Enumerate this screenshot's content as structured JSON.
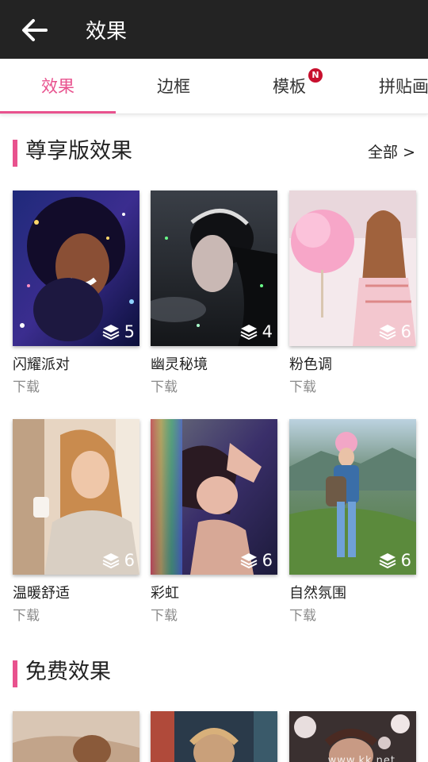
{
  "header": {
    "title": "效果",
    "back_icon": "arrow-left-icon"
  },
  "tabs": [
    {
      "label": "效果",
      "active": true
    },
    {
      "label": "边框",
      "active": false
    },
    {
      "label": "模板",
      "active": false,
      "badge": "N"
    },
    {
      "label": "拼贴画",
      "active": false
    }
  ],
  "premium": {
    "title": "尊享版效果",
    "all_label": "全部 >",
    "items": [
      {
        "name": "闪耀派对",
        "status": "下载",
        "count": "5"
      },
      {
        "name": "幽灵秘境",
        "status": "下载",
        "count": "4"
      },
      {
        "name": "粉色调",
        "status": "下载",
        "count": "6"
      },
      {
        "name": "温暖舒适",
        "status": "下载",
        "count": "6"
      },
      {
        "name": "彩虹",
        "status": "下载",
        "count": "6"
      },
      {
        "name": "自然氛围",
        "status": "下载",
        "count": "6"
      }
    ]
  },
  "free": {
    "title": "免费效果"
  },
  "watermark": "www.kk.net",
  "colors": {
    "accent": "#e8528e",
    "topbar": "#232323",
    "badge": "#c8102e"
  }
}
